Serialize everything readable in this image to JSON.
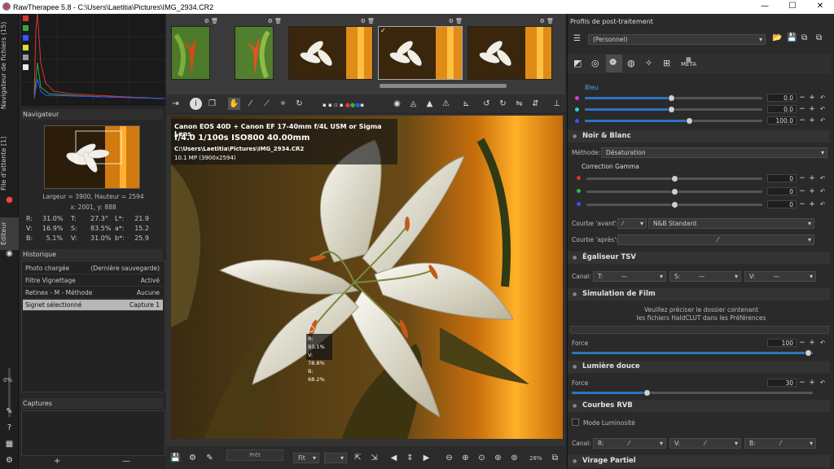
{
  "window": {
    "title": "RawTherapee 5.8 - C:\\Users\\Laetitia\\Pictures\\IMG_2934.CR2",
    "min": "—",
    "max": "☐",
    "close": "✕"
  },
  "vtabs": {
    "nav": "Navigateur de fichiers (15)",
    "queue": "File d'attente [1]",
    "editor": "Éditeur"
  },
  "left": {
    "navigator_title": "Navigateur",
    "size": "Largeur = 3900, Hauteur = 2594",
    "coords": "x: 2001, y: 888",
    "readout": [
      {
        "a": "R:",
        "b": "31.0%",
        "c": "T:",
        "d": "27.3°",
        "e": "L*:",
        "f": "21.9"
      },
      {
        "a": "V:",
        "b": "16.9%",
        "c": "S:",
        "d": "83.5%",
        "e": "a*:",
        "f": "15.2"
      },
      {
        "a": "B:",
        "b": "5.1%",
        "c": "V:",
        "d": "31.0%",
        "e": "b*:",
        "f": "25.9"
      }
    ],
    "history_title": "Historique",
    "history": [
      {
        "a": "Photo chargée",
        "b": "(Dernière sauvegarde)"
      },
      {
        "a": "Filtre Vignettage",
        "b": "Activé"
      },
      {
        "a": "Retinex - M - Méthode",
        "b": "Aucune"
      },
      {
        "a": "Signet sélectionné",
        "b": "Capture 1"
      }
    ],
    "captures_title": "Captures",
    "add": "+",
    "remove": "—",
    "zoom_pct": "0%"
  },
  "overlay": {
    "camera": "Canon EOS 40D + Canon EF 17-40mm f/4L USM or Sigma Lens",
    "exposure": "f/4.0  1/100s  ISO800  40.00mm",
    "path": "C:\\Users\\Laetitia\\Pictures\\IMG_2934.CR2",
    "mp": "10.1 MP (3900x2594)",
    "pick_r": "R: 93.1%",
    "pick_v": "V: 78.8%",
    "pick_b": "B: 68.2%"
  },
  "bottom": {
    "zoom": "28%",
    "preset": "Fit"
  },
  "right": {
    "profile_title": "Profils de post-traitement",
    "profile_value": "(Personnel)",
    "bleu_label": "Bleu",
    "bleu_vals": [
      "0.0",
      "0.0",
      "100.0"
    ],
    "nb_title": "Noir & Blanc",
    "method_label": "Méthode:",
    "method_value": "Désaturation",
    "gamma_label": "Correction Gamma",
    "gamma_vals": [
      "0",
      "0",
      "0"
    ],
    "curve_before_label": "Courbe 'avant':",
    "curve_before_value": "N&B Standard",
    "curve_after_label": "Courbe 'après':",
    "tsv_title": "Égaliseur TSV",
    "canal_label": "Canal:",
    "tsv_t": "T:",
    "tsv_s": "S:",
    "tsv_v": "V:",
    "film_title": "Simulation de Film",
    "film_msg1": "Veuillez préciser le dossier contenant",
    "film_msg2": "les fichiers HaldCLUT dans les Préférences",
    "force_label": "Force",
    "film_force": "100",
    "soft_title": "Lumière douce",
    "soft_force": "30",
    "rgb_title": "Courbes RVB",
    "lum_mode": "Mode Luminosité",
    "rgb_r": "R:",
    "rgb_v": "V:",
    "rgb_b": "B:",
    "virage_title": "Virage Partiel"
  }
}
